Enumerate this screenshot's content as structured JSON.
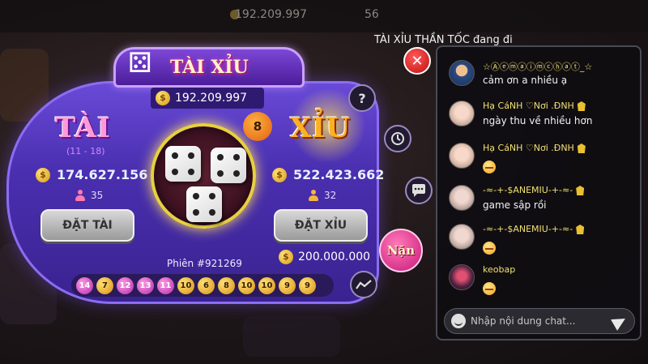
{
  "background": {
    "coins": "192.209.997",
    "gems": "56"
  },
  "status": "TÀI XỈU THẦN TỐC đang đi",
  "game": {
    "title": "TÀI XỈU",
    "jackpot": "192.209.997",
    "timer": "8",
    "tai": {
      "label": "TÀI",
      "range": "(11 - 18)",
      "amount": "174.627.156",
      "players": "35",
      "bet_label": "ĐẶT TÀI"
    },
    "xiu": {
      "label": "XỈU",
      "amount": "522.423.662",
      "players": "32",
      "bet_label": "ĐẶT XỈU"
    },
    "session": "Phiên #921269",
    "session_amount": "200.000.000",
    "nan_label": "Nặn",
    "dice": [
      4,
      4,
      4
    ],
    "history": [
      {
        "value": "14",
        "side": "tai"
      },
      {
        "value": "7",
        "side": "xiu"
      },
      {
        "value": "12",
        "side": "tai"
      },
      {
        "value": "13",
        "side": "tai"
      },
      {
        "value": "11",
        "side": "tai"
      },
      {
        "value": "10",
        "side": "xiu"
      },
      {
        "value": "6",
        "side": "xiu"
      },
      {
        "value": "8",
        "side": "xiu"
      },
      {
        "value": "10",
        "side": "xiu"
      },
      {
        "value": "10",
        "side": "xiu"
      },
      {
        "value": "9",
        "side": "xiu"
      },
      {
        "value": "9",
        "side": "xiu"
      }
    ],
    "icons": {
      "help": "?",
      "close": "✕"
    }
  },
  "chat": {
    "messages": [
      {
        "name": "☆Ⓐⓔⓜⓐⓘⓜⓒⓗⓐⓣ_☆",
        "text": "cảm ơn a nhiều ạ"
      },
      {
        "name": "Hạ CáNH ♡Nơi .ĐNH",
        "text": "ngày thu về nhiều hơn"
      },
      {
        "name": "Hạ CáNH ♡Nơi .ĐNH",
        "text": ""
      },
      {
        "name": "-≈-+-$ANEMIU-+-≈-",
        "text": "game sập rồi"
      },
      {
        "name": "-≈-+-$ANEMIU-+-≈-",
        "text": ""
      },
      {
        "name": "keobap",
        "text": ""
      }
    ],
    "input_placeholder": "Nhập nội dung chat..."
  }
}
